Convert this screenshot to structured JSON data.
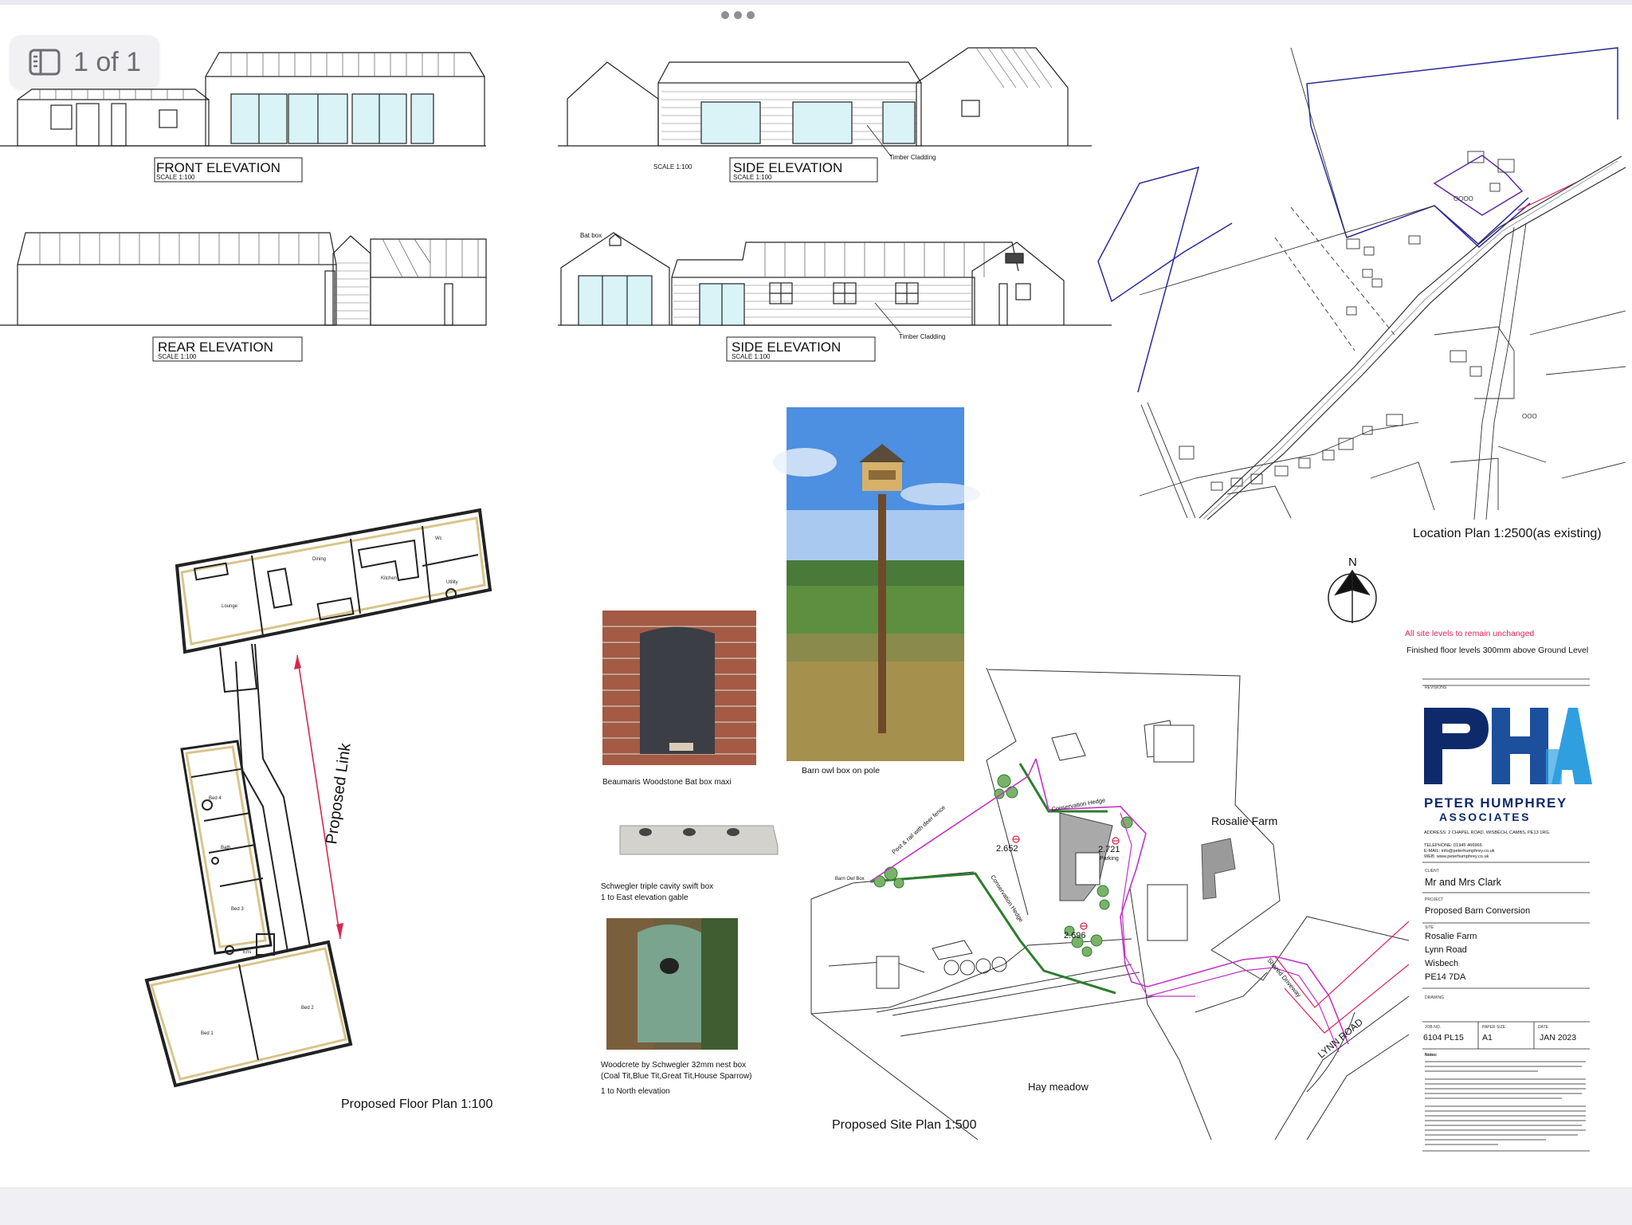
{
  "viewer": {
    "page_indicator": "1 of 1",
    "more_icon": "ellipsis-icon",
    "sidebar_icon": "sidebar-toggle-icon"
  },
  "elevations": {
    "front": {
      "title": "FRONT ELEVATION",
      "scale": "SCALE 1:100"
    },
    "side_1": {
      "title": "SIDE ELEVATION",
      "scale": "SCALE 1:100",
      "scale_note": "SCALE 1:100",
      "cladding": "Timber Cladding"
    },
    "rear": {
      "title": "REAR ELEVATION",
      "scale": "SCALE 1:100"
    },
    "side_2": {
      "title": "SIDE ELEVATION",
      "scale": "SCALE 1:100",
      "cladding": "Timber Cladding",
      "bat_box": "Bat box"
    }
  },
  "floor_plan": {
    "caption": "Proposed  Floor Plan 1:100",
    "link_label": "Proposed Link",
    "rooms": [
      "Lounge",
      "Dining",
      "Kitchen",
      "Wc",
      "Utility",
      "Bed 4",
      "Bath",
      "Bed 3",
      "Ens",
      "Bed 1",
      "Bed 2"
    ]
  },
  "photos": {
    "bat_box": "Beaumaris Woodstone Bat box maxi",
    "owl_box": "Barn owl box on pole",
    "swift_box_line1": "Schwegler triple cavity swift box",
    "swift_box_line2": "1 to East elevation gable",
    "nest_box_line1": "Woodcrete by Schwegler 32mm nest box",
    "nest_box_line2": "(Coal Tit,Blue Tit,Great Tit,House Sparrow)",
    "nest_box_line3": "1 to  North elevation"
  },
  "location_plan": {
    "caption": "Location Plan 1:2500(as existing)",
    "north": "N"
  },
  "site_plan": {
    "caption": "Proposed  Site Plan 1:500",
    "labels": {
      "rosalie": "Rosalie Farm",
      "hay": "Hay meadow",
      "lynn": "LYNN ROAD",
      "shared": "Shared Driveway",
      "cons1": "Conservation Hedge",
      "cons2": "Conservation Hedge",
      "post": "Post & rail with deer fence",
      "barn_owl": "Barn Owl Box",
      "parking": "Parking",
      "lvl1": "2.652",
      "lvl2": "2.721",
      "lvl3": "2.696"
    }
  },
  "notes": {
    "levels_red": "All site levels to remain unchanged",
    "levels": "Finished floor levels 300mm above Ground Level"
  },
  "title_block": {
    "revisions": "REVISIONS",
    "logo_letters": "PHA",
    "company_line1": "PETER HUMPHREY",
    "company_line2": "ASSOCIATES",
    "address": "ADDRESS: 2 CHAPEL ROAD, WISBECH, CAMBS, PE13 1RG.",
    "telephone": "TELEPHONE: 01945 466966",
    "email": "E-MAIL: info@peterhumphrey.co.uk",
    "web": "WEB: www.peterhumphrey.co.uk",
    "client_label": "CLIENT",
    "client": "Mr and Mrs Clark",
    "project_label": "PROJECT",
    "project": "Proposed Barn Conversion",
    "site_label": "SITE",
    "site_lines": [
      "Rosalie Farm",
      "Lynn Road",
      "Wisbech",
      "PE14 7DA"
    ],
    "drawing_label": "DRAWING",
    "job_label": "JOB NO.",
    "job": "6104 PL15",
    "paper_label": "PAPER SIZE",
    "paper": "A1",
    "date_label": "DATE",
    "date": "JAN 2023",
    "notes_label": "Notes:"
  },
  "colors": {
    "pha_dark": "#0f2a6b",
    "pha_light": "#2f9fe0",
    "red": "#e0245e",
    "magenta": "#c233c9",
    "hedge": "#2d7d2d"
  }
}
